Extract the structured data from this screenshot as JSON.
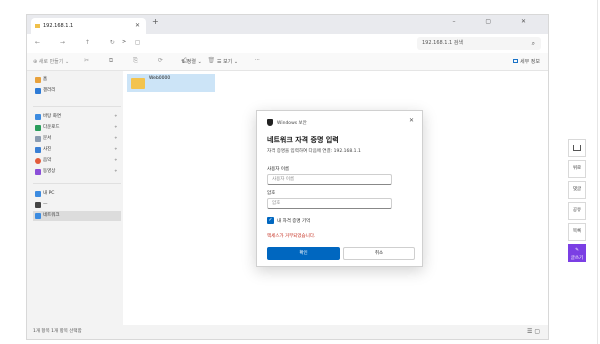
{
  "tab": {
    "title": "192.168.1.1",
    "close": "✕",
    "new": "+"
  },
  "window_controls": "–  ▢  ✕",
  "nav": "← → ↑ ↻ ▢",
  "address": {
    "path": ">",
    "search_placeholder": "192.168.1.1 검색"
  },
  "command_bar": {
    "new": "⊕ 새로 만들기 ⌄",
    "sort": "⇅ 정렬 ⌄",
    "view": "☰ 보기 ⌄",
    "more": "···",
    "details": "세부 정보"
  },
  "sidebar": {
    "quick": [
      {
        "label": "홈",
        "color": "#e8a13b"
      },
      {
        "label": "갤러리",
        "color": "#2e7bd6"
      }
    ],
    "pinned": [
      {
        "label": "바탕 화면",
        "color": "#3c8be0"
      },
      {
        "label": "다운로드",
        "color": "#2a9d5b"
      },
      {
        "label": "문서",
        "color": "#8a9bb0"
      },
      {
        "label": "사진",
        "color": "#3a7fd4"
      },
      {
        "label": "음악",
        "color": "#e25b3a"
      },
      {
        "label": "동영상",
        "color": "#8b4fd8"
      }
    ],
    "tree": [
      {
        "label": "내 PC",
        "color": "#3c8be0"
      },
      {
        "label": "—",
        "color": "#444444"
      },
      {
        "label": "네트워크",
        "color": "#3c8be0"
      }
    ]
  },
  "content": {
    "folder": "Web0000"
  },
  "statusbar": {
    "text": "1개 항목   1개 항목 선택함",
    "view_icons": "☰ ▢"
  },
  "dialog": {
    "header": "Windows 보안",
    "close": "✕",
    "title": "네트워크 자격 증명 입력",
    "description": "자격 증명을 입력하여 다음에 연결: 192.168.1.1",
    "username_label": "사용자 이름",
    "username_placeholder": "사용자 이름",
    "password_label": "암호",
    "password_placeholder": "암호",
    "remember": "내 자격 증명 기억",
    "error": "액세스가 거부되었습니다.",
    "ok": "확인",
    "cancel": "취소"
  },
  "rightbar": {
    "like": "좋아요",
    "comment": "댓글",
    "share": "공유",
    "list": "목록",
    "write": "글쓰기",
    "top": "위로"
  }
}
